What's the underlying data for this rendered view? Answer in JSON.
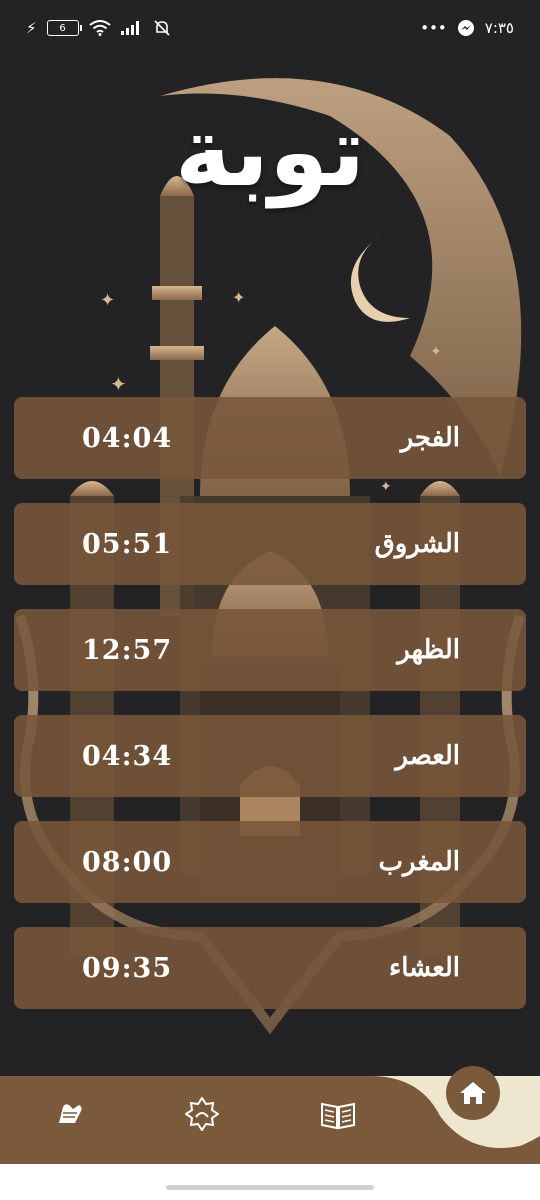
{
  "status_bar": {
    "battery": "6",
    "time": "٧:٣٥",
    "more": "•••"
  },
  "app": {
    "title": "توبة"
  },
  "prayers": [
    {
      "name": "الفجر",
      "time": "04:04"
    },
    {
      "name": "الشروق",
      "time": "05:51"
    },
    {
      "name": "الظهر",
      "time": "12:57"
    },
    {
      "name": "العصر",
      "time": "04:34"
    },
    {
      "name": "المغرب",
      "time": "08:00"
    },
    {
      "name": "العشاء",
      "time": "09:35"
    }
  ],
  "nav": {
    "items": [
      {
        "icon": "dua-hands-icon"
      },
      {
        "icon": "allah-emblem-icon"
      },
      {
        "icon": "quran-book-icon"
      },
      {
        "icon": "home-icon"
      }
    ]
  },
  "colors": {
    "background": "#232325",
    "card": "#78563a",
    "nav": "#7b5a3b",
    "nav_cream": "#efe6cf",
    "gold": "#c9a57a"
  }
}
